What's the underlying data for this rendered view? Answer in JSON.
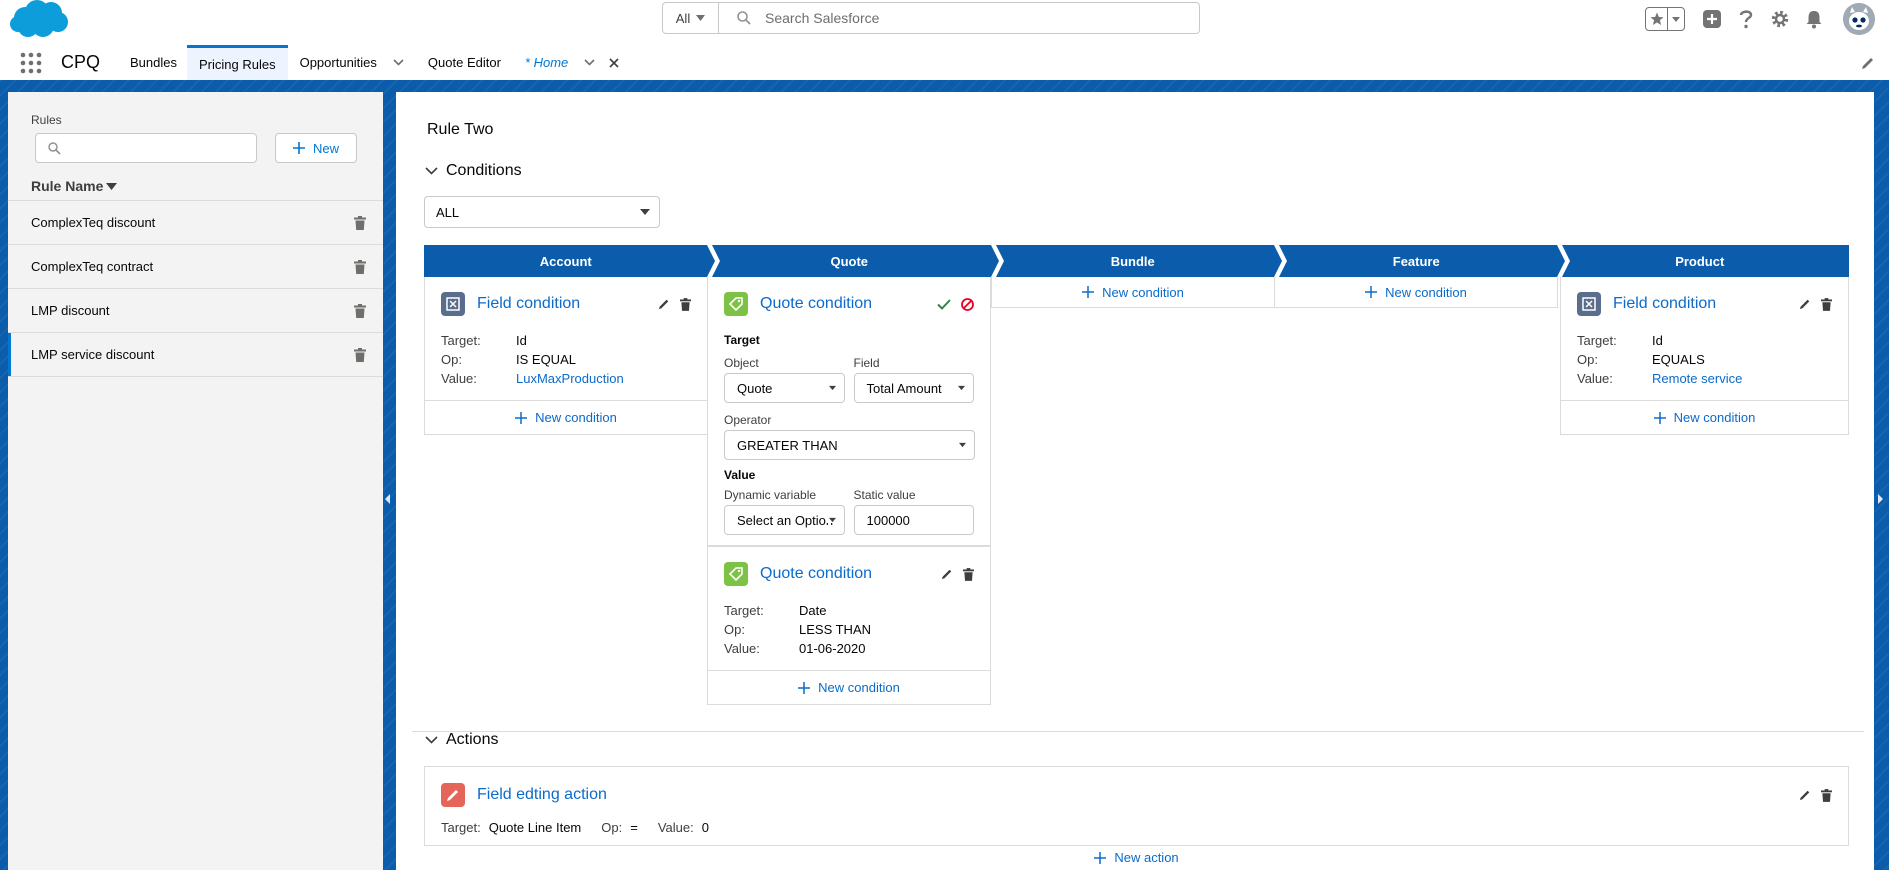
{
  "global_header": {
    "search_scope": "All",
    "search_placeholder": "Search Salesforce"
  },
  "nav": {
    "app_name": "CPQ",
    "items": [
      {
        "label": "Bundles",
        "active": false
      },
      {
        "label": "Pricing Rules",
        "active": true
      },
      {
        "label": "Opportunities",
        "active": false
      },
      {
        "label": "Quote Editor",
        "active": false
      }
    ],
    "temp_tab": "* Home"
  },
  "left_panel": {
    "rules_label": "Rules",
    "search_value": "",
    "new_button": "New",
    "column_header": "Rule Name",
    "rules": [
      "ComplexTeq discount",
      "ComplexTeq contract",
      "LMP discount",
      "LMP service discount"
    ],
    "selected_index": 3
  },
  "main": {
    "rule_title": "Rule Two",
    "conditions_header": "Conditions",
    "logic_select": "ALL",
    "path_steps": [
      "Account",
      "Quote",
      "Bundle",
      "Feature",
      "Product"
    ],
    "new_condition_label": "New condition",
    "account": {
      "title": "Field condition",
      "target_key": "Target:",
      "target": "Id",
      "op_key": "Op:",
      "op": "IS EQUAL",
      "value_key": "Value:",
      "value": "LuxMaxProduction"
    },
    "quote_edit": {
      "title": "Quote condition",
      "target_label": "Target",
      "object_label": "Object",
      "object_value": "Quote",
      "field_label": "Field",
      "field_value": "Total Amount",
      "operator_label": "Operator",
      "operator_value": "GREATER THAN",
      "value_label": "Value",
      "dynamic_label": "Dynamic variable",
      "dynamic_value": "Select an Option",
      "static_label": "Static value",
      "static_value": "100000"
    },
    "quote_view": {
      "title": "Quote condition",
      "target_key": "Target:",
      "target": "Date",
      "op_key": "Op:",
      "op": "LESS THAN",
      "value_key": "Value:",
      "value": "01-06-2020"
    },
    "product": {
      "title": "Field condition",
      "target_key": "Target:",
      "target": "Id",
      "op_key": "Op:",
      "op": "EQUALS",
      "value_key": "Value:",
      "value": "Remote service"
    },
    "actions_header": "Actions",
    "action": {
      "title": "Field edting action",
      "target_key": "Target:",
      "target": "Quote Line Item",
      "op_key": "Op:",
      "op": "=",
      "value_key": "Value:",
      "value": "0"
    },
    "new_action_label": "New action"
  },
  "colors": {
    "brand": "#0b5cab",
    "path_blue": "#0b5cab",
    "link": "#0b6bcb",
    "field_icon": "#5b6d8c",
    "quote_icon": "#7cc244",
    "action_icon": "#e56659"
  }
}
